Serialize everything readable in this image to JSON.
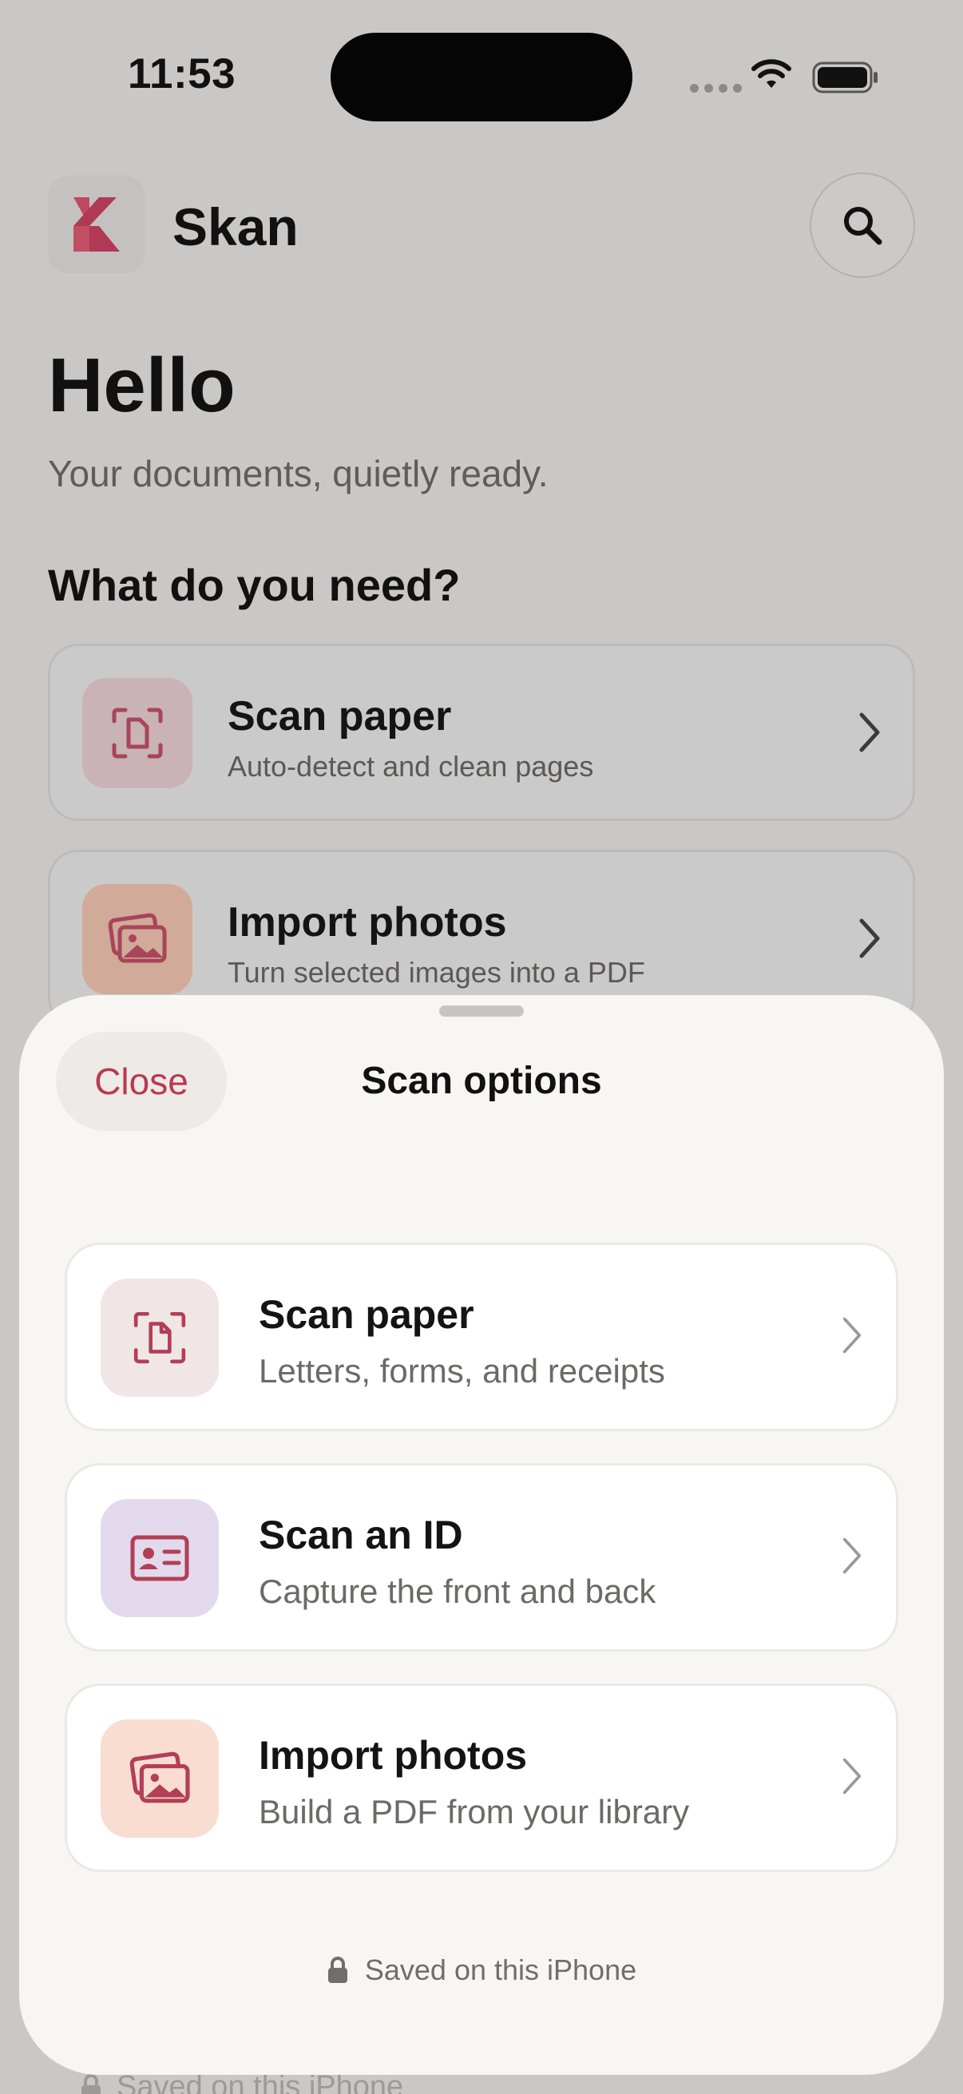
{
  "status_bar": {
    "time": "11:53"
  },
  "app": {
    "name": "Skan"
  },
  "home": {
    "greeting": "Hello",
    "tagline": "Your documents, quietly ready.",
    "section_title": "What do you need?",
    "cards": [
      {
        "title": "Scan paper",
        "subtitle": "Auto-detect and clean pages",
        "icon": "document-scan-icon"
      },
      {
        "title": "Import photos",
        "subtitle": "Turn selected images into a PDF",
        "icon": "photos-icon"
      }
    ],
    "footer": "Saved on this iPhone"
  },
  "sheet": {
    "close_label": "Close",
    "title": "Scan options",
    "options": [
      {
        "title": "Scan paper",
        "subtitle": "Letters, forms, and receipts",
        "icon": "document-scan-icon",
        "tint": "#f1e6e6"
      },
      {
        "title": "Scan an ID",
        "subtitle": "Capture the front and back",
        "icon": "id-card-icon",
        "tint": "#e2daec"
      },
      {
        "title": "Import photos",
        "subtitle": "Build a PDF from your library",
        "icon": "photos-icon",
        "tint": "#f8ddd0"
      }
    ],
    "footer": "Saved on this iPhone"
  },
  "colors": {
    "accent": "#b83a4f",
    "sheet_bg": "#f8f6f3",
    "scrim": "#c9c8c7"
  }
}
